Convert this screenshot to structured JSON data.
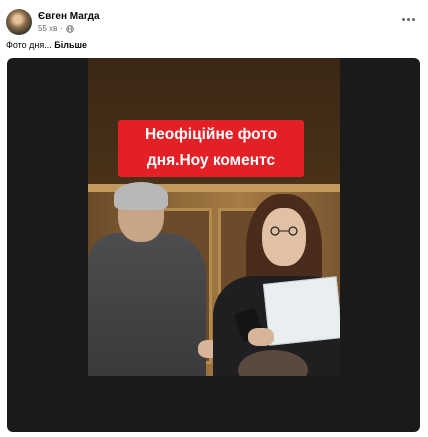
{
  "post": {
    "author": "Євген Магда",
    "time": "55 хв",
    "separator": "·",
    "caption": "Фото дня...",
    "see_more": "Більше"
  },
  "photo": {
    "overlay_text": "Неофіційне фото дня.Ноу коментс"
  },
  "colors": {
    "overlay_bg": "#e32026",
    "frame_bg": "#1a1a1a",
    "meta_text": "#65676b"
  },
  "icons": {
    "privacy": "globe-icon",
    "menu": "more-options-icon"
  }
}
